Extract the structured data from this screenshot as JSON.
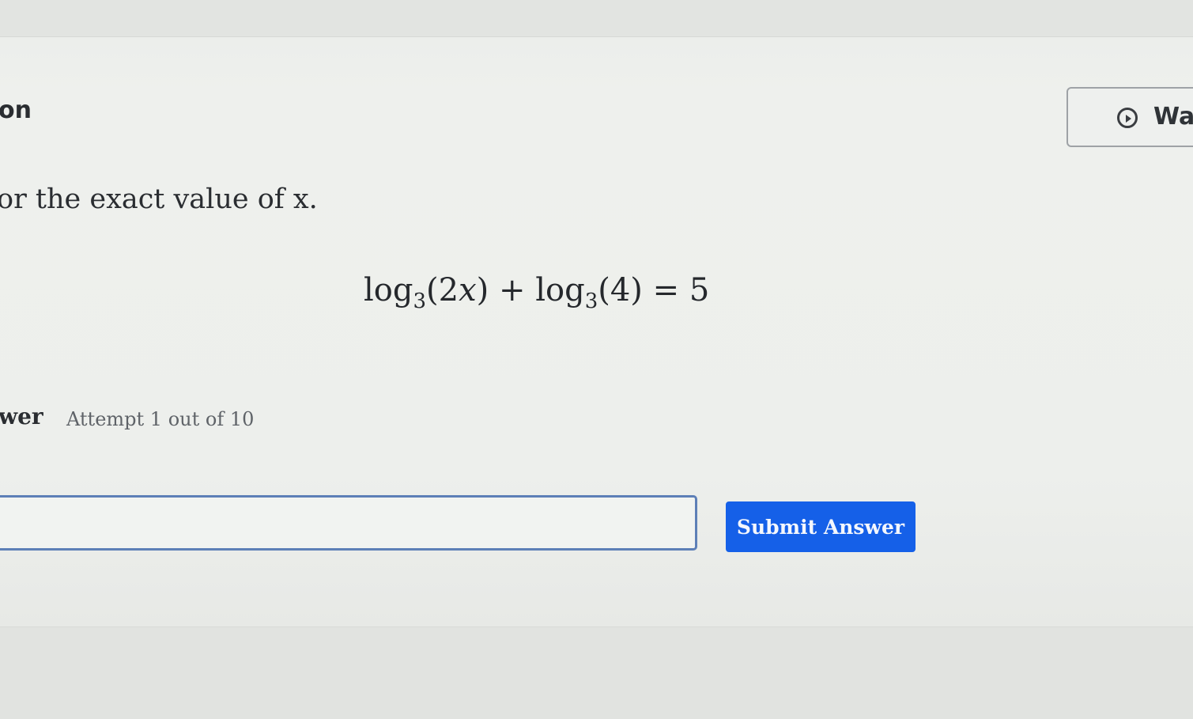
{
  "header": {
    "section_title": "on"
  },
  "watch_button": {
    "icon": "play-circle-icon",
    "label": "Wa"
  },
  "question": {
    "instruction": "or the exact value of x.",
    "equation": {
      "term1_fn": "log",
      "term1_base": "3",
      "term1_arg_open": "(2",
      "term1_var": "x",
      "term1_arg_close": ")",
      "operator": " + ",
      "term2_fn": "log",
      "term2_base": "3",
      "term2_arg": "(4)",
      "equals": " = ",
      "rhs": "5"
    }
  },
  "answer": {
    "label": "wer",
    "attempt_text": "Attempt 1 out of 10",
    "input_value": "",
    "submit_label": "Submit Answer"
  },
  "colors": {
    "submit_button": "#1560e8",
    "input_border": "#5d7fb7",
    "background": "#e9ebe8"
  }
}
